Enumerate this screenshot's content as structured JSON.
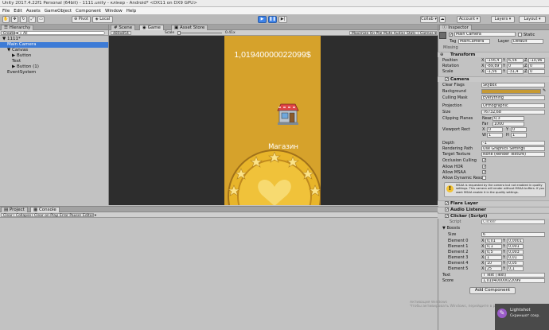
{
  "window": {
    "title": "Unity 2017.4.22f1 Personal (64bit) - 1111.unity - клікер - Android* <DX11 on DX9 GPU>"
  },
  "menu": [
    "File",
    "Edit",
    "Assets",
    "GameObject",
    "Component",
    "Window",
    "Help"
  ],
  "toolbar": {
    "pivot": "Pivot",
    "local": "Local",
    "collab": "Collab",
    "account": "Account",
    "layers": "Layers",
    "layout": "Layout"
  },
  "hierarchy": {
    "tab": "Hierarchy",
    "create": "Create",
    "search_placeholder": "All",
    "items": [
      {
        "label": "1111*",
        "indent": 0,
        "arrow": "▼"
      },
      {
        "label": "Main Camera",
        "indent": 1,
        "arrow": "",
        "selected": true
      },
      {
        "label": "Canvas",
        "indent": 1,
        "arrow": "▼"
      },
      {
        "label": "Button",
        "indent": 2,
        "arrow": "▶"
      },
      {
        "label": "Text",
        "indent": 2,
        "arrow": ""
      },
      {
        "label": "Button (1)",
        "indent": 2,
        "arrow": "▶"
      },
      {
        "label": "EventSystem",
        "indent": 1,
        "arrow": ""
      }
    ]
  },
  "tabs": {
    "scene": "Scene",
    "game": "Game",
    "asset_store": "Asset Store"
  },
  "game": {
    "resolution": "480x854",
    "scale_label": "Scale",
    "scale_value": "0.41x",
    "maximize": "Maximize On Play",
    "mute": "Mute Audio",
    "stats": "Stats",
    "gizmos": "Gizmos",
    "score_text": "1,01940000022099$",
    "shop_label": "Магазин",
    "bg_color": "#d6a22b"
  },
  "project": {
    "tab": "Project",
    "console_tab": "Console",
    "clear": "Clear",
    "collapse": "Collapse",
    "clear_on_play": "Clear on Play",
    "error_pause": "Error Pause",
    "editor": "Editor"
  },
  "inspector": {
    "tab": "Inspector",
    "object_name": "Main Camera",
    "tag_label": "Tag",
    "tag_value": "MainCamera",
    "layer_label": "Layer",
    "layer_value": "Default",
    "static": "Static",
    "prefab_missing": "Missing",
    "transform": {
      "header": "Transform",
      "rows": [
        {
          "label": "Position",
          "x": "-156,4",
          "y": "6,56",
          "z": "-10,96"
        },
        {
          "label": "Rotation",
          "x": "-89,89",
          "y": "0",
          "z": "0"
        },
        {
          "label": "Scale",
          "x": "-1,56",
          "y": "-31,4",
          "z": "0"
        }
      ]
    },
    "camera": {
      "header": "Camera",
      "clear_flags_label": "Clear Flags",
      "clear_flags": "Skybox",
      "background_label": "Background",
      "background_color": "#c79a33",
      "culling_label": "Culling Mask",
      "culling": "Everything",
      "projection_label": "Projection",
      "projection": "Orthographic",
      "size_label": "Size",
      "size": "76732,68",
      "clipping_label": "Clipping Planes",
      "near_label": "Near",
      "near": "0,3",
      "far_label": "Far",
      "far": "1000",
      "viewport_label": "Viewport Rect",
      "vx": "0",
      "vy": "0",
      "vw": "1",
      "vh": "1",
      "depth_label": "Depth",
      "depth": "-1",
      "render_path_label": "Rendering Path",
      "render_path": "Use Graphics Settings",
      "target_texture_label": "Target Texture",
      "target_texture": "None (Render Texture)",
      "occlusion_label": "Occlusion Culling",
      "hdr_label": "Allow HDR",
      "msaa_label": "Allow MSAA",
      "dyn_label": "Allow Dynamic Reso",
      "warning": "MSAA is requested by the camera but not enabled in quality settings. This camera will render without MSAA buffers. If you want MSAA enable it in the quality settings."
    },
    "flare_layer": "Flare Layer",
    "audio_listener": "Audio Listener",
    "clicker": {
      "header": "Clicker (Script)",
      "script_label": "Script",
      "script_value": "Clicker",
      "boosts_label": "Boosts",
      "size_label": "Size",
      "size": "6",
      "elements": [
        {
          "label": "Element 0",
          "x": "0,01",
          "y": "0,0001"
        },
        {
          "label": "Element 1",
          "x": "0,1",
          "y": "0,001"
        },
        {
          "label": "Element 2",
          "x": "0,5",
          "y": "0,003"
        },
        {
          "label": "Element 3",
          "x": "1",
          "y": "0,01"
        },
        {
          "label": "Element 4",
          "x": "10",
          "y": "0,05"
        },
        {
          "label": "Element 5",
          "x": "25",
          "y": "0,1"
        }
      ],
      "text_label": "Text",
      "text_value": "Text (Text)",
      "score_label": "Score",
      "score_value": "1,01940000022099"
    },
    "add_component": "Add Component"
  },
  "overlay": {
    "lightshot": "Lightshot",
    "lightshot_sub": "Скриншот сохр.",
    "activate": "Активация Windows",
    "activate_sub": "Чтобы активировать Windows, перейдите в раздел «Параметры»."
  }
}
